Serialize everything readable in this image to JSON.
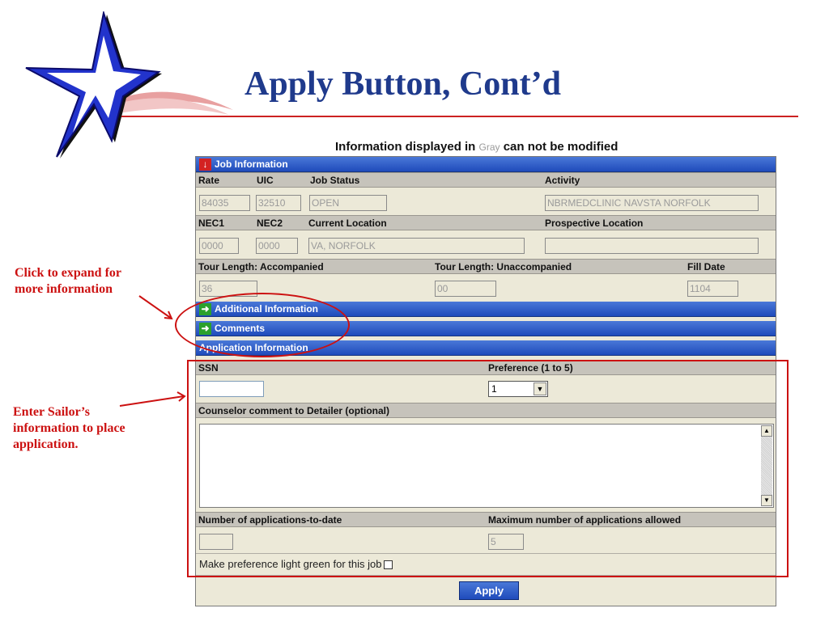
{
  "slide": {
    "title": "Apply Button, Cont’d"
  },
  "caption": {
    "before": "Information displayed in ",
    "gray_word": "Gray",
    "after": " can not be modified"
  },
  "colors": {
    "title_blue": "#1f3a8c",
    "annotation_red": "#cc1111",
    "section_blue": "#1f4bbb",
    "form_bg": "#ece9d8"
  },
  "annotations": {
    "expand_note": [
      "Click to expand for",
      "more information"
    ],
    "enter_note": [
      "Enter Sailor’s",
      "information to place",
      "application."
    ]
  },
  "job_information": {
    "header": "Job Information",
    "icon": "red-down-arrow-icon",
    "row1_labels": {
      "rate": "Rate",
      "uic": "UIC",
      "job_status": "Job Status",
      "activity": "Activity"
    },
    "row1_values": {
      "rate": "84035",
      "uic": "32510",
      "job_status": "OPEN",
      "activity": "NBRMEDCLINIC NAVSTA NORFOLK"
    },
    "row2_labels": {
      "nec1": "NEC1",
      "nec2": "NEC2",
      "current_location": "Current Location",
      "prospective_location": "Prospective Location"
    },
    "row2_values": {
      "nec1": "0000",
      "nec2": "0000",
      "current_location": "VA, NORFOLK",
      "prospective_location": ""
    },
    "row3_labels": {
      "tour_acc": "Tour Length: Accompanied",
      "tour_unacc": "Tour Length: Unaccompanied",
      "fill_date": "Fill Date"
    },
    "row3_values": {
      "tour_acc": "36",
      "tour_unacc": "00",
      "fill_date": "1104"
    }
  },
  "additional_information": {
    "header": "Additional Information",
    "icon": "green-right-arrow-icon"
  },
  "comments": {
    "header": "Comments",
    "icon": "green-right-arrow-icon"
  },
  "application_information": {
    "header": "Application Information",
    "ssn_label": "SSN",
    "ssn_value": "",
    "preference_label": "Preference (1 to 5)",
    "preference_value": "1",
    "comment_label": "Counselor comment to Detailer (optional)",
    "comment_value": "",
    "apps_to_date_label": "Number of applications-to-date",
    "apps_to_date_value": "",
    "max_apps_label": "Maximum number of applications allowed",
    "max_apps_value": "5",
    "light_green_label": "Make preference light green for this job",
    "light_green_checked": false
  },
  "buttons": {
    "apply": "Apply"
  }
}
